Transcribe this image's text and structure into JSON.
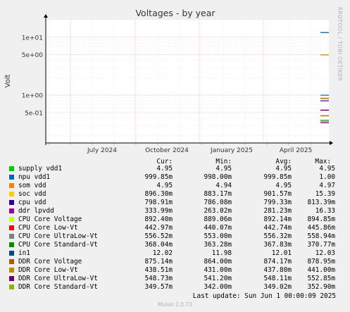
{
  "chart_data": {
    "type": "line",
    "title": "Voltages - by year",
    "ylabel": "Volt",
    "yscale": "log",
    "ylim": [
      0.15,
      20
    ],
    "y_ticks": [
      {
        "value": 10,
        "label": "1e+01"
      },
      {
        "value": 5,
        "label": "5e+00"
      },
      {
        "value": 1,
        "label": "1e+00"
      },
      {
        "value": 0.5,
        "label": "5e-01"
      }
    ],
    "x_ticks": [
      "July 2024",
      "October 2024",
      "January 2025",
      "April 2025"
    ],
    "grid": true,
    "series": [
      {
        "name": "supply vdd1",
        "color": "#00cc00",
        "cur": "4.95",
        "min": "4.95",
        "avg": "4.95",
        "max": "4.95",
        "value": 4.95
      },
      {
        "name": "npu vdd1",
        "color": "#0066b3",
        "cur": "999.85m",
        "min": "998.00m",
        "avg": "999.85m",
        "max": "1.00",
        "value": 0.99985
      },
      {
        "name": "som vdd",
        "color": "#ff8000",
        "cur": "4.95",
        "min": "4.94",
        "avg": "4.95",
        "max": "4.97",
        "value": 4.95
      },
      {
        "name": "soc vdd",
        "color": "#ffcc00",
        "cur": "896.30m",
        "min": "883.17m",
        "avg": "901.57m",
        "max": "15.39",
        "value": 0.8963
      },
      {
        "name": "cpu vdd",
        "color": "#330099",
        "cur": "798.91m",
        "min": "786.08m",
        "avg": "799.33m",
        "max": "813.39m",
        "value": 0.79891
      },
      {
        "name": "ddr lpvdd",
        "color": "#990099",
        "cur": "333.99m",
        "min": "263.02m",
        "avg": "281.23m",
        "max": "16.33",
        "value": 0.33399
      },
      {
        "name": "CPU Core Voltage",
        "color": "#ccff00",
        "cur": "892.40m",
        "min": "889.06m",
        "avg": "892.14m",
        "max": "894.85m",
        "value": 0.8924
      },
      {
        "name": "CPU Core Low-Vt",
        "color": "#ff0000",
        "cur": "442.97m",
        "min": "440.07m",
        "avg": "442.74m",
        "max": "445.86m",
        "value": 0.44297
      },
      {
        "name": "CPU Core UltraLow-Vt",
        "color": "#808080",
        "cur": "556.52m",
        "min": "553.00m",
        "avg": "556.32m",
        "max": "558.94m",
        "value": 0.55652
      },
      {
        "name": "CPU Core Standard-Vt",
        "color": "#008f00",
        "cur": "368.04m",
        "min": "363.28m",
        "avg": "367.83m",
        "max": "370.77m",
        "value": 0.36804
      },
      {
        "name": "in1",
        "color": "#00487d",
        "cur": "12.02",
        "min": "11.98",
        "avg": "12.01",
        "max": "12.03",
        "value": 12.02
      },
      {
        "name": "DDR Core Voltage",
        "color": "#b35a00",
        "cur": "875.14m",
        "min": "864.00m",
        "avg": "874.17m",
        "max": "878.95m",
        "value": 0.87514
      },
      {
        "name": "DDR Core Low-Vt",
        "color": "#b38f00",
        "cur": "438.51m",
        "min": "431.00m",
        "avg": "437.80m",
        "max": "441.00m",
        "value": 0.43851
      },
      {
        "name": "DDR Core UltraLow-Vt",
        "color": "#6b006b",
        "cur": "548.73m",
        "min": "541.20m",
        "avg": "548.11m",
        "max": "552.85m",
        "value": 0.54873
      },
      {
        "name": "DDR Core Standard-Vt",
        "color": "#8fb300",
        "cur": "349.57m",
        "min": "342.00m",
        "avg": "349.02m",
        "max": "352.90m",
        "value": 0.34957
      }
    ]
  },
  "legend_headers": {
    "cur": "Cur:",
    "min": "Min:",
    "avg": "Avg:",
    "max": "Max:"
  },
  "last_update": "Last update: Sun Jun  1 00:00:09 2025",
  "footer": "Munin 2.0.73",
  "watermark": "RRDTOOL / TOBI OETIKER"
}
